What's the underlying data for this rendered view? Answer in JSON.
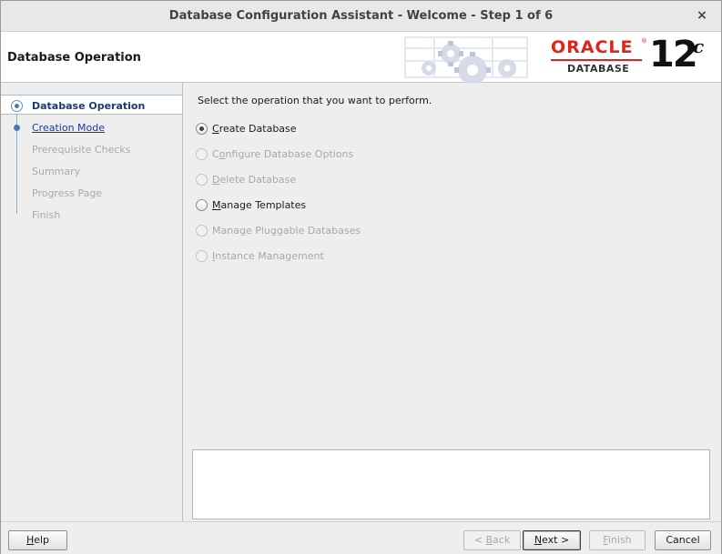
{
  "window": {
    "title": "Database Configuration Assistant - Welcome - Step 1 of 6",
    "close_glyph": "×"
  },
  "header": {
    "section_title": "Database Operation",
    "brand": {
      "oracle": "ORACLE",
      "registered": "®",
      "database": "DATABASE",
      "version": "12",
      "version_sup": "c",
      "color": "#e2231a"
    }
  },
  "steps": [
    {
      "label": "Database Operation",
      "state": "current"
    },
    {
      "label": "Creation Mode",
      "state": "link"
    },
    {
      "label": "Prerequisite Checks",
      "state": "disabled"
    },
    {
      "label": "Summary",
      "state": "disabled"
    },
    {
      "label": "Progress Page",
      "state": "disabled"
    },
    {
      "label": "Finish",
      "state": "disabled"
    }
  ],
  "content": {
    "prompt": "Select the operation that you want to perform.",
    "options": [
      {
        "label": "Create Database",
        "mnemonic": "C",
        "rest": "reate Database",
        "checked": true,
        "enabled": true
      },
      {
        "label": "Configure Database Options",
        "pre": "C",
        "mnemonic": "o",
        "rest": "nfigure Database Options",
        "checked": false,
        "enabled": false
      },
      {
        "label": "Delete Database",
        "mnemonic": "D",
        "rest": "elete Database",
        "checked": false,
        "enabled": false
      },
      {
        "label": "Manage Templates",
        "mnemonic": "M",
        "rest": "anage Templates",
        "checked": false,
        "enabled": true
      },
      {
        "label": "Manage Pluggable Databases",
        "pre": "Mana",
        "mnemonic": "g",
        "rest": "e Pluggable Databases",
        "checked": false,
        "enabled": false
      },
      {
        "label": "Instance Management",
        "mnemonic": "I",
        "rest": "nstance Management",
        "checked": false,
        "enabled": false
      }
    ]
  },
  "buttons": {
    "help": {
      "pre": "",
      "mnemonic": "H",
      "rest": "elp"
    },
    "back": {
      "pre": "< ",
      "mnemonic": "B",
      "rest": "ack"
    },
    "next": {
      "pre": "",
      "mnemonic": "N",
      "rest": "ext >"
    },
    "finish": {
      "pre": "",
      "mnemonic": "F",
      "rest": "inish"
    },
    "cancel": {
      "pre": "",
      "mnemonic": "",
      "rest": "Cancel"
    }
  }
}
